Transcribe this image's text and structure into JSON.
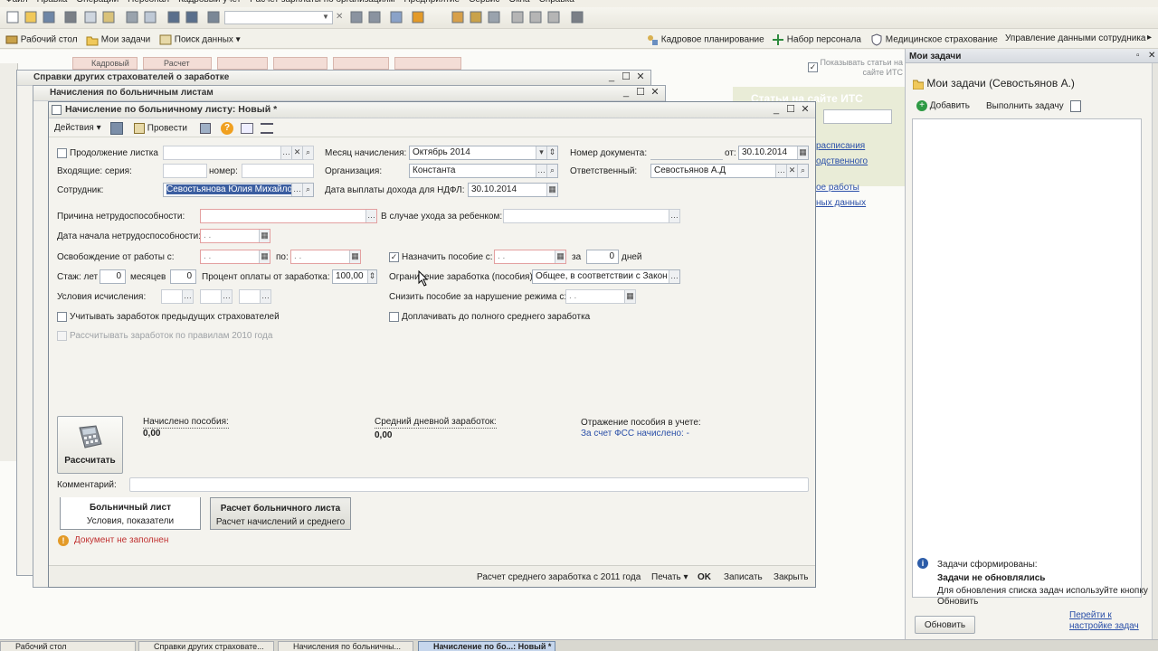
{
  "menu": {
    "items": [
      "Файл",
      "Правка",
      "Операции",
      "Персонал",
      "Кадровый учет",
      "Расчет зарплаты по организациям",
      "Предприятие",
      "Сервис",
      "Окна",
      "Справка"
    ]
  },
  "panel": {
    "left": [
      "Рабочий стол",
      "Мои задачи",
      "Поиск данных"
    ],
    "right": [
      "Кадровое планирование",
      "Набор персонала",
      "Медицинское страхование",
      "Управление данными сотрудника"
    ]
  },
  "bg_tabs": [
    "Кадровый",
    "Расчет"
  ],
  "bg_windows": {
    "spravki": "Справки других страхователей о заработке",
    "nachisleniya": "Начисления по больничным листам"
  },
  "its": {
    "checkbox_label": "Показывать статьи на сайте ИТС",
    "title": "Статьи на сайте ИТС",
    "links": [
      "расписания",
      "одственного",
      "ое работы",
      "ных данных"
    ]
  },
  "main_form": {
    "title": "Начисление по больничному листу: Новый *",
    "toolbar": {
      "actions": "Действия",
      "post": "Провести"
    },
    "labels": {
      "continuation": "Продолжение листка",
      "incoming_series": "Входящие: серия:",
      "number": "номер:",
      "employee": "Сотрудник:",
      "accrual_month": "Месяц начисления:",
      "organization": "Организация:",
      "pay_date": "Дата выплаты дохода для НДФЛ:",
      "doc_number": "Номер документа:",
      "from": "от:",
      "responsible": "Ответственный:",
      "disability_reason": "Причина нетрудоспособности:",
      "child_care": "В случае ухода за ребенком:",
      "disability_start": "Дата начала нетрудоспособности:",
      "release_from": "Освобождение от работы с:",
      "to": "по:",
      "assign_benefit": "Назначить пособие с:",
      "for": "за",
      "days": "дней",
      "experience_years": "Стаж: лет",
      "months": "месяцев",
      "payment_percent": "Процент оплаты от заработка:",
      "earnings_limit": "Ограничение заработка (пособия):",
      "calc_conditions": "Условия исчисления:",
      "reduce_benefit": "Снизить пособие за нарушение режима с:",
      "account_prev": "Учитывать заработок предыдущих страхователей",
      "topup": "Доплачивать до полного среднего заработка",
      "rules_2010": "Рассчитывать заработок по правилам 2010 года"
    },
    "values": {
      "accrual_month": "Октябрь 2014",
      "organization": "Константа",
      "employee": "Севостьянова Юлия Михайло",
      "pay_date": "30.10.2014",
      "doc_date": "30.10.2014",
      "responsible": "Севостьянов А.Д",
      "date_mask": " .  .",
      "days_count": "0",
      "years": "0",
      "months": "0",
      "percent": "100,00",
      "earnings_limit": "Общее, в соответствии с Закон"
    },
    "results": {
      "calculate": "Рассчитать",
      "accrued_label": "Начислено пособия:",
      "accrued_value": "0,00",
      "avg_label": "Средний дневной заработок:",
      "avg_value": "0,00",
      "reflection_label": "Отражение пособия в учете:",
      "reflection_link": "За счет ФСС начислено: -"
    },
    "comment_label": "Комментарий:",
    "tabs": [
      {
        "title": "Больничный лист",
        "sub": "Условия, показатели"
      },
      {
        "title": "Расчет больничного листа",
        "sub": "Расчет начислений и среднего"
      }
    ],
    "warning": "Документ не заполнен",
    "bottom": {
      "calc_link": "Расчет среднего заработка с 2011 года",
      "print": "Печать",
      "ok": "OK",
      "save": "Записать",
      "close": "Закрыть"
    }
  },
  "tasks": {
    "panel_title": "Мои задачи",
    "header": "Мои задачи (Севостьянов А.)",
    "add": "Добавить",
    "execute": "Выполнить задачу",
    "formed": "Задачи сформированы:",
    "not_updated": "Задачи не обновлялись",
    "hint": "Для обновления списка задач используйте кнопку Обновить",
    "update_btn": "Обновить",
    "settings_link": "Перейти к настройке задач"
  },
  "taskbar": [
    "Рабочий стол",
    "Справки других страховате...",
    "Начисления по больничны...",
    "Начисление по бо...: Новый *"
  ]
}
